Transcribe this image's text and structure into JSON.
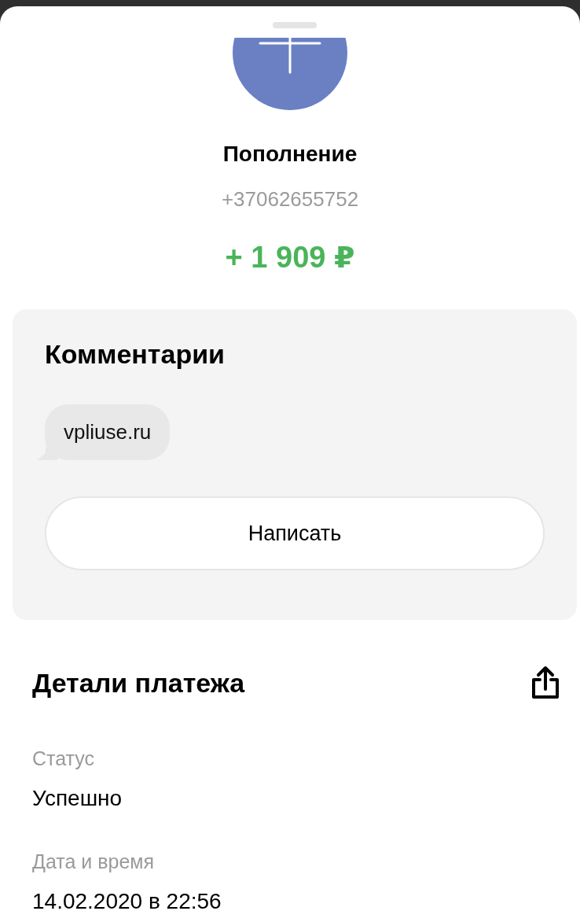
{
  "header": {
    "title": "Пополнение",
    "phone": "+37062655752",
    "amount": "+ 1 909 ₽"
  },
  "comments": {
    "title": "Комментарии",
    "messages": [
      "vpliuse.ru"
    ],
    "button": "Написать"
  },
  "details": {
    "title": "Детали платежа",
    "fields": [
      {
        "label": "Статус",
        "value": "Успешно"
      },
      {
        "label": "Дата и время",
        "value": "14.02.2020 в 22:56"
      }
    ]
  }
}
